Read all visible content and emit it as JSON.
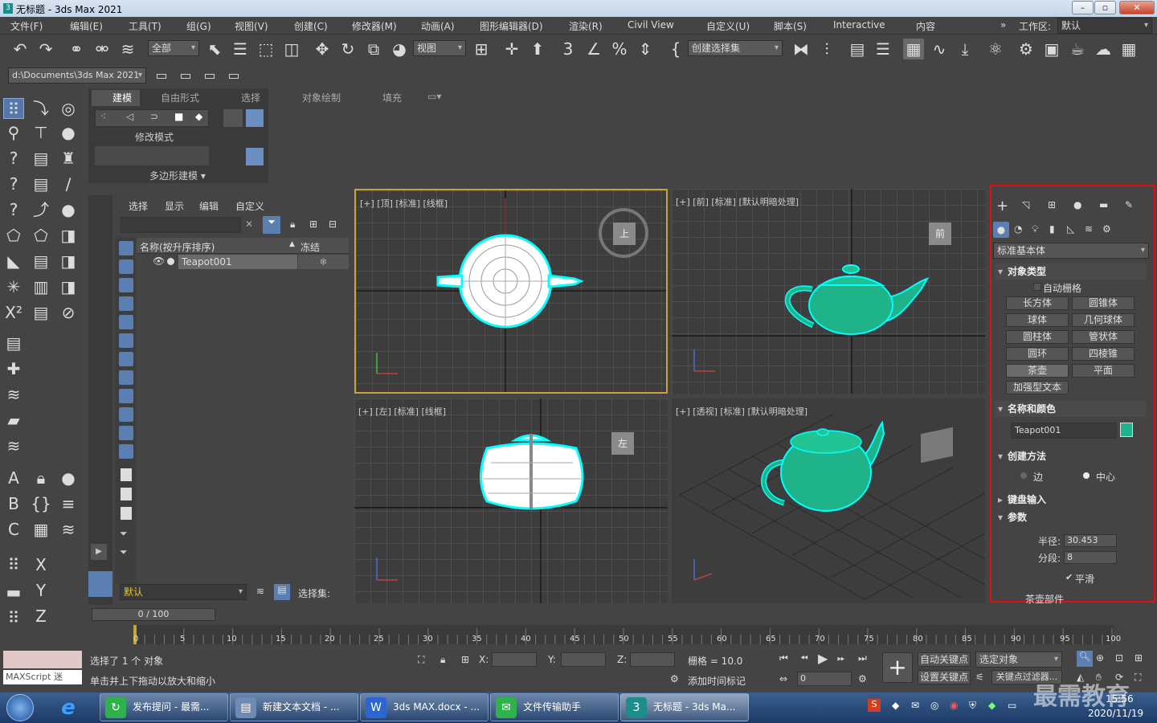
{
  "window": {
    "title": "无标题 - 3ds Max 2021",
    "logo": "3"
  },
  "menu": [
    "文件(F)",
    "编辑(E)",
    "工具(T)",
    "组(G)",
    "视图(V)",
    "创建(C)",
    "修改器(M)",
    "动画(A)",
    "图形编辑器(D)",
    "渲染(R)",
    "Civil View",
    "自定义(U)",
    "脚本(S)",
    "Interactive",
    "内容"
  ],
  "workspace": {
    "label": "工作区:",
    "value": "默认"
  },
  "toolbar": {
    "filter": "全部",
    "ref_coord": "视图",
    "selection_set": "创建选择集",
    "path": "d:\\Documents\\3ds Max 2021"
  },
  "ribbon": {
    "tabs": [
      "建模",
      "自由形式",
      "选择",
      "对象绘制",
      "填充"
    ],
    "mode": "修改模式",
    "footer": "多边形建模"
  },
  "scene_explorer": {
    "menu": [
      "选择",
      "显示",
      "编辑",
      "自定义"
    ],
    "col_name": "名称(按升序排序)",
    "col_sort": "▲",
    "col_frozen": "冻结",
    "row": "Teapot001",
    "layer": "默认",
    "selset_label": "选择集:"
  },
  "viewports": {
    "top": {
      "label": "[+] [顶] [标准] [线框]",
      "cube": "上"
    },
    "front": {
      "label": "[+] [前] [标准] [默认明暗处理]",
      "cube": "前"
    },
    "left": {
      "label": "[+] [左] [标准] [线框]",
      "cube": "左"
    },
    "persp": {
      "label": "[+] [透视] [标准] [默认明暗处理]"
    }
  },
  "command_panel": {
    "category": "标准基本体",
    "object_type": "对象类型",
    "autogrid": "自动栅格",
    "buttons": [
      "长方体",
      "圆锥体",
      "球体",
      "几何球体",
      "圆柱体",
      "管状体",
      "圆环",
      "四棱锥",
      "茶壶",
      "平面",
      "加强型文本"
    ],
    "name_color": "名称和颜色",
    "object_name": "Teapot001",
    "object_color": "#16b08a",
    "creation_method": "创建方法",
    "edge": "边",
    "center": "中心",
    "keyboard_entry": "键盘输入",
    "params": "参数",
    "radius_label": "半径:",
    "radius": "30.453",
    "segments_label": "分段:",
    "segments": "8",
    "smooth": "平滑",
    "parts": "茶壶部件"
  },
  "timeline": {
    "frame": "0 / 100",
    "ticks": [
      "0",
      "5",
      "10",
      "15",
      "20",
      "25",
      "30",
      "35",
      "40",
      "45",
      "50",
      "55",
      "60",
      "65",
      "70",
      "75",
      "80",
      "85",
      "90",
      "95",
      "100"
    ]
  },
  "status": {
    "maxscript": "MAXScript 迷",
    "selected": "选择了 1 个 对象",
    "hint": "单击并上下拖动以放大和缩小",
    "x": "X:",
    "y": "Y:",
    "z": "Z:",
    "grid": "栅格 = 10.0",
    "add_time_tag": "添加时间标记",
    "auto_key": "自动关键点",
    "selected_obj": "选定对象",
    "set_key": "设置关键点",
    "key_filters": "关键点过滤器...",
    "frame_field": "0"
  },
  "taskbar": {
    "tasks": [
      "发布提问 - 最需...",
      "新建文本文档 - ...",
      "3ds MAX.docx - ...",
      "文件传输助手",
      "无标题 - 3ds Ma..."
    ],
    "time": "15:56",
    "date": "2020/11/19",
    "watermark": "最需教育"
  },
  "colors": {
    "accent_red": "#e01010",
    "teapot": "#1fb38a",
    "selection": "#00ffff"
  }
}
